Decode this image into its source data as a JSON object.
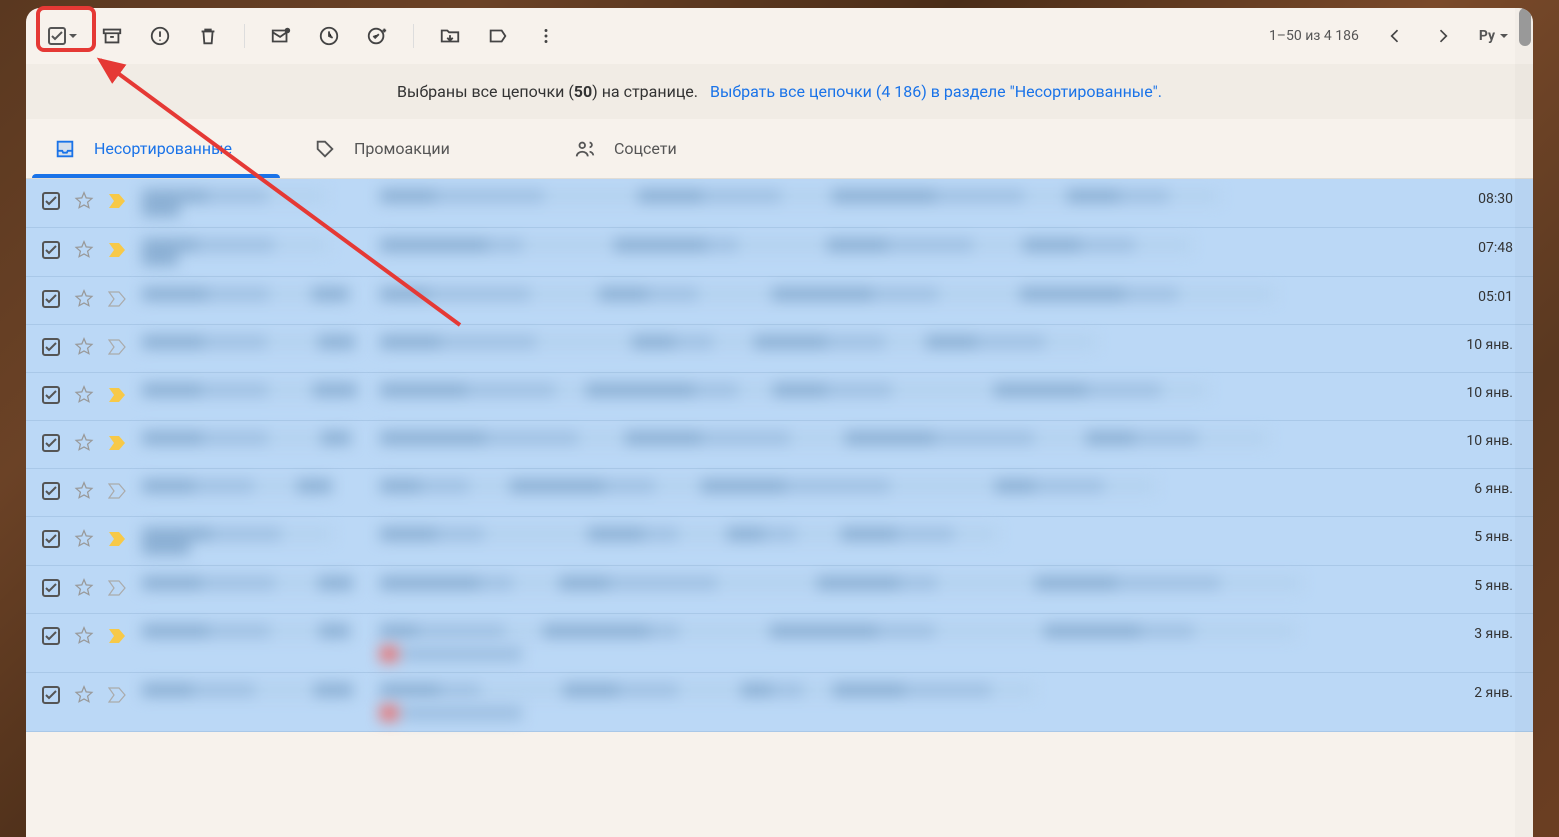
{
  "toolbar": {
    "page_info": "1–50 из 4 186",
    "input_lang": "Ру"
  },
  "banner": {
    "text_before": "Выбраны все цепочки (",
    "count": "50",
    "text_after": ") на странице.",
    "link": "Выбрать все цепочки (4 186) в разделе \"Несортированные\"."
  },
  "tabs": [
    {
      "label": "Несортированные"
    },
    {
      "label": "Промоакции"
    },
    {
      "label": "Соцсети"
    }
  ],
  "rows": [
    {
      "time": "08:30",
      "imp": true
    },
    {
      "time": "07:48",
      "imp": true
    },
    {
      "time": "05:01",
      "imp": false
    },
    {
      "time": "10 янв.",
      "imp": false
    },
    {
      "time": "10 янв.",
      "imp": true
    },
    {
      "time": "10 янв.",
      "imp": true
    },
    {
      "time": "6 янв.",
      "imp": false
    },
    {
      "time": "5 янв.",
      "imp": true
    },
    {
      "time": "5 янв.",
      "imp": false
    },
    {
      "time": "3 янв.",
      "imp": true,
      "two_line": true
    },
    {
      "time": "2 янв.",
      "imp": false,
      "two_line": true
    }
  ]
}
